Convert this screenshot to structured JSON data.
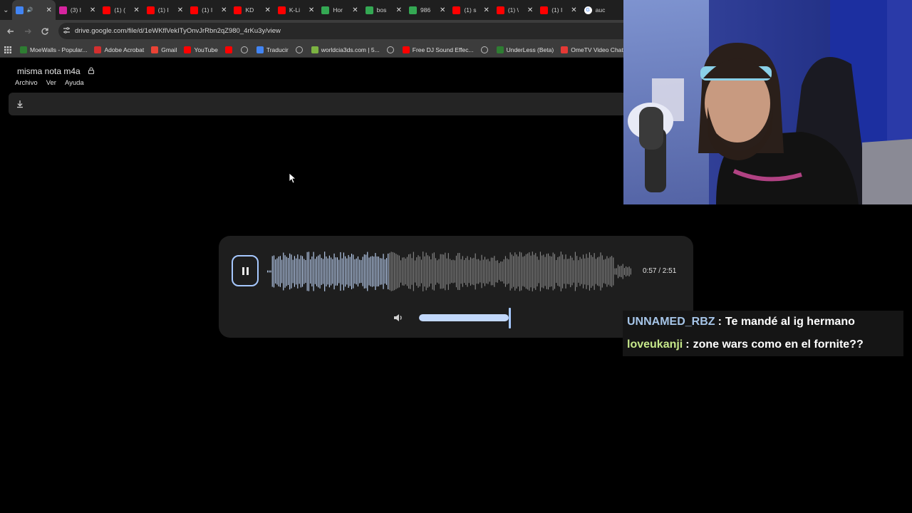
{
  "browser": {
    "tabs": [
      {
        "label": "",
        "favicon": "drive-icon",
        "color": "#4285f4",
        "audio": true,
        "active": true
      },
      {
        "label": "(3) I",
        "favicon": "instagram-icon",
        "color": "#d6249f"
      },
      {
        "label": "(1) (",
        "favicon": "youtube-icon",
        "color": "#ff0000"
      },
      {
        "label": "(1) I",
        "favicon": "youtube-icon",
        "color": "#ff0000"
      },
      {
        "label": "(1) I",
        "favicon": "youtube-icon",
        "color": "#ff0000"
      },
      {
        "label": "KD",
        "favicon": "youtube-icon",
        "color": "#ff0000"
      },
      {
        "label": "K-Li",
        "favicon": "youtube-icon",
        "color": "#ff0000"
      },
      {
        "label": "Hor",
        "favicon": "drive-icon",
        "color": "#34a853"
      },
      {
        "label": "bos",
        "favicon": "drive-icon",
        "color": "#34a853"
      },
      {
        "label": "986",
        "favicon": "drive-icon",
        "color": "#34a853"
      },
      {
        "label": "(1) s",
        "favicon": "youtube-icon",
        "color": "#ff0000"
      },
      {
        "label": "(1) \\",
        "favicon": "youtube-icon",
        "color": "#ff0000"
      },
      {
        "label": "(1) I",
        "favicon": "youtube-icon",
        "color": "#ff0000"
      },
      {
        "label": "auc",
        "favicon": "google-icon",
        "color": "#ffffff"
      }
    ],
    "url": "drive.google.com/file/d/1eWKflVekITyOnvJrRbn2qZ980_4rKu3y/view",
    "bookmarks": [
      {
        "label": "MoeWalls - Popular...",
        "icon": "moewalls-icon",
        "color": "#2e7d32"
      },
      {
        "label": "Adobe Acrobat",
        "icon": "acrobat-icon",
        "color": "#d32f2f"
      },
      {
        "label": "Gmail",
        "icon": "gmail-icon",
        "color": "#ea4335"
      },
      {
        "label": "YouTube",
        "icon": "youtube-icon",
        "color": "#ff0000"
      },
      {
        "label": "",
        "icon": "youtube-icon",
        "color": "#ff0000"
      },
      {
        "label": "",
        "icon": "globe-icon",
        "color": "#777777"
      },
      {
        "label": "Traducir",
        "icon": "translate-icon",
        "color": "#4285f4"
      },
      {
        "label": "",
        "icon": "globe-icon",
        "color": "#777777"
      },
      {
        "label": "worldcia3ds.com | 5...",
        "icon": "worldcia-icon",
        "color": "#7cb342"
      },
      {
        "label": "",
        "icon": "globe-icon",
        "color": "#777777"
      },
      {
        "label": "Free DJ Sound Effec...",
        "icon": "youtube-icon",
        "color": "#ff0000"
      },
      {
        "label": "",
        "icon": "globe-icon",
        "color": "#777777"
      },
      {
        "label": "UnderLess (Beta)",
        "icon": "underless-icon",
        "color": "#2e7d32"
      },
      {
        "label": "OmeTV Video Chat...",
        "icon": "ometv-icon",
        "color": "#e53935"
      }
    ]
  },
  "drive": {
    "title": "misma nota  m4a",
    "menu": [
      "Archivo",
      "Ver",
      "Ayuda"
    ]
  },
  "player": {
    "time": "0:57 / 2:51",
    "progress": 0.333,
    "volume": 1.0,
    "accent": "#a6c8ff",
    "played_color": "#c2d8fb",
    "unplayed_color": "#8a8a8a"
  },
  "chat": [
    {
      "user": "UNNAMED_RBZ",
      "user_color": "#a6c5e8",
      "message": "Te mandé al ig hermano"
    },
    {
      "user": "loveukanji",
      "user_color": "#c6e88a",
      "message": "zone wars como en el fornite??"
    }
  ]
}
